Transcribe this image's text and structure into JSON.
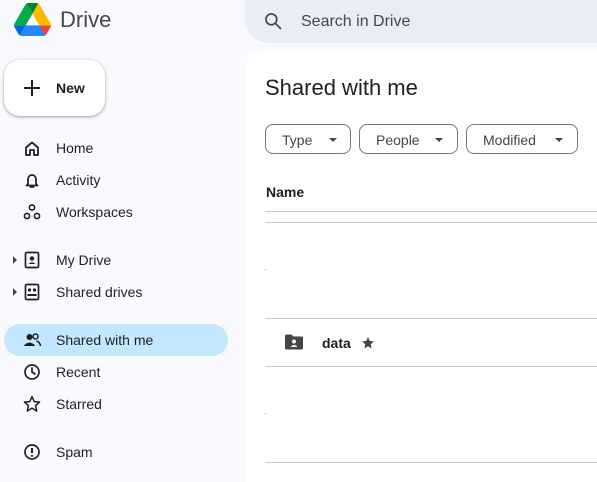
{
  "app": {
    "title": "Drive",
    "logo_icon": "google-drive-logo",
    "brand_colors": [
      "#1e8e3e",
      "#fbbc04",
      "#4285f4",
      "#1967d2"
    ]
  },
  "search": {
    "placeholder": "Search in Drive",
    "value": "",
    "icon": "search-icon"
  },
  "new_button": {
    "label": "New",
    "icon": "plus-icon"
  },
  "sidebar": {
    "active_color": "#c2e7ff",
    "items": [
      {
        "label": "Home",
        "icon": "home-icon",
        "active": false
      },
      {
        "label": "Activity",
        "icon": "bell-icon",
        "active": false
      },
      {
        "label": "Workspaces",
        "icon": "workspaces-icon",
        "active": false
      },
      {
        "label": "My Drive",
        "icon": "my-drive-icon",
        "active": false,
        "expandable": true
      },
      {
        "label": "Shared drives",
        "icon": "shared-drives-icon",
        "active": false,
        "expandable": true
      },
      {
        "label": "Shared with me",
        "icon": "people-icon",
        "active": true
      },
      {
        "label": "Recent",
        "icon": "clock-icon",
        "active": false
      },
      {
        "label": "Starred",
        "icon": "star-outline-icon",
        "active": false
      },
      {
        "label": "Spam",
        "icon": "spam-icon",
        "active": false
      }
    ]
  },
  "main": {
    "title": "Shared with me",
    "filters": [
      {
        "label": "Type"
      },
      {
        "label": "People"
      },
      {
        "label": "Modified"
      }
    ],
    "columns": {
      "name": "Name"
    },
    "rows": [
      {
        "name": "data",
        "icon": "shared-folder-icon",
        "starred": true
      }
    ]
  }
}
